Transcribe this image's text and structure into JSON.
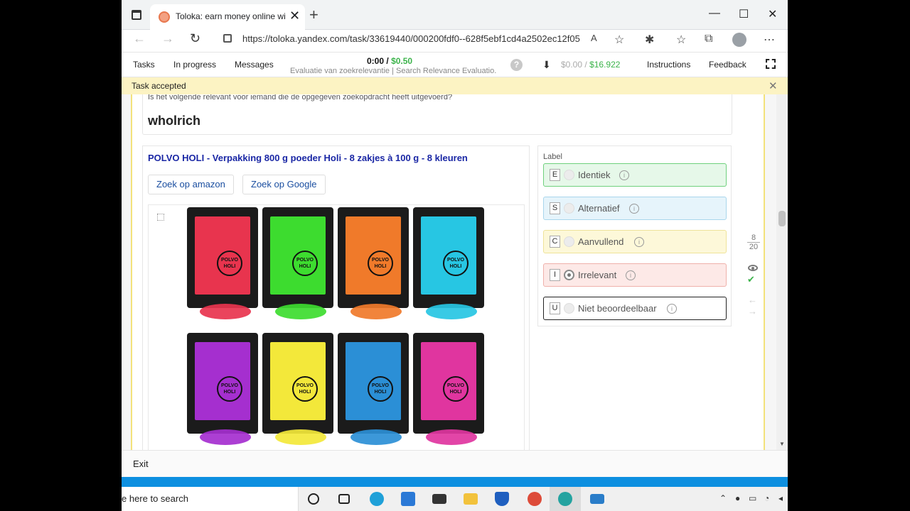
{
  "browser": {
    "tab_title": "Toloka: earn money online with",
    "url": "https://toloka.yandex.com/task/33619440/000200fdf0--628f5ebf1cd4a2502ec12f05"
  },
  "toloka": {
    "nav": [
      "Tasks",
      "In progress",
      "Messages"
    ],
    "timer": "0:00",
    "timer_sep": "/",
    "reward": "$0.50",
    "project": "Evaluatie van zoekrelevantie | Search Relevance Evaluatio...",
    "balance_today": "$0.00",
    "balance_sep": "/",
    "balance_total": "$16.922",
    "instructions": "Instructions",
    "feedback": "Feedback",
    "help_glyph": "?"
  },
  "notice": {
    "text": "Task accepted"
  },
  "task": {
    "question": "Is het volgende relevant voor iemand die de opgegeven zoekopdracht heeft uitgevoerd?",
    "query": "wholrich",
    "product_title": "POLVO HOLI - Verpakking 800 g poeder Holi - 8 zakjes à 100 g - 8 kleuren",
    "search_amazon": "Zoek op amazon",
    "search_google": "Zoek op Google",
    "bag_logo_line1": "POLVO",
    "bag_logo_line2": "HOLI",
    "bag_colors": [
      "#e8344e",
      "#3ddc2f",
      "#f07a2a",
      "#27c6e3",
      "#a52fcf",
      "#f3e83a",
      "#2b8fd6",
      "#e0359f"
    ],
    "label_caption": "Label",
    "options": [
      {
        "key": "E",
        "label": "Identiek",
        "bg": "#e6f8e9",
        "border": "#6fd07d",
        "selected": false
      },
      {
        "key": "S",
        "label": "Alternatief",
        "bg": "#e6f4fb",
        "border": "#a9d6ec",
        "selected": false
      },
      {
        "key": "C",
        "label": "Aanvullend",
        "bg": "#fdf8d9",
        "border": "#eee39a",
        "selected": false
      },
      {
        "key": "I",
        "label": "Irrelevant",
        "bg": "#fde9e7",
        "border": "#efb1ab",
        "selected": true
      },
      {
        "key": "U",
        "label": "Niet beoordeelbaar",
        "bg": "#ffffff",
        "border": "#222222",
        "selected": false
      }
    ],
    "counter_current": "8",
    "counter_total": "20"
  },
  "footer": {
    "exit": "Exit"
  },
  "taskbar": {
    "search_placeholder": "e here to search"
  }
}
